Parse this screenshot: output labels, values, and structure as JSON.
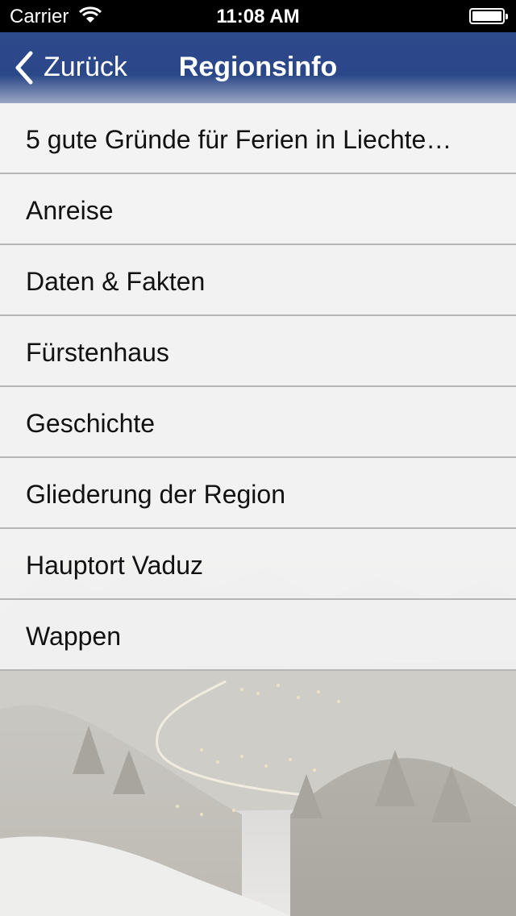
{
  "status_bar": {
    "carrier": "Carrier",
    "time": "11:08 AM",
    "wifi_icon": "wifi-icon",
    "battery_icon": "battery-icon"
  },
  "nav_bar": {
    "back_label": "Zurück",
    "back_icon": "chevron-left-icon",
    "title": "Regionsinfo",
    "color": "#2c478a"
  },
  "list": {
    "items": [
      {
        "label": "5 gute Gründe für Ferien in Liechte…"
      },
      {
        "label": "Anreise"
      },
      {
        "label": "Daten & Fakten"
      },
      {
        "label": "Fürstenhaus"
      },
      {
        "label": "Geschichte"
      },
      {
        "label": "Gliederung der Region"
      },
      {
        "label": "Hauptort Vaduz"
      },
      {
        "label": "Wappen"
      }
    ]
  }
}
